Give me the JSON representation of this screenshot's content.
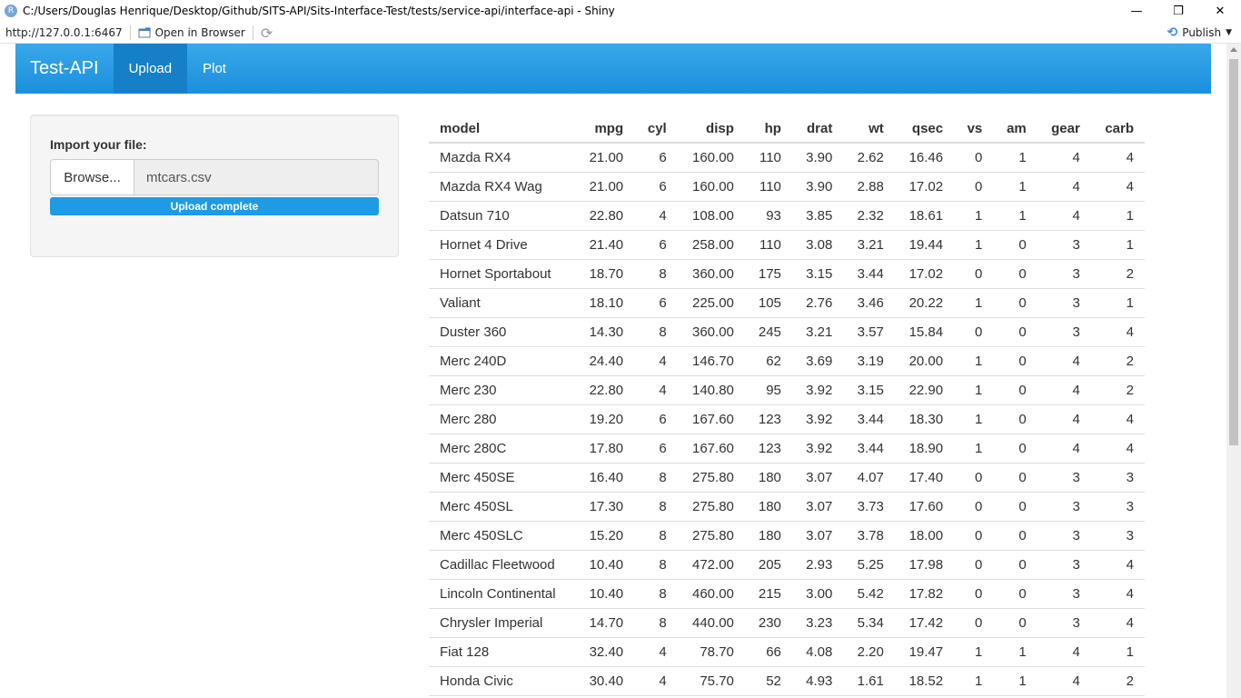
{
  "window": {
    "title": "C:/Users/Douglas Henrique/Desktop/Github/SITS-API/Sits-Interface-Test/tests/service-api/interface-api - Shiny",
    "controls": {
      "minimize": "—",
      "restore": "❐",
      "close": "✕"
    }
  },
  "toolbar": {
    "url": "http://127.0.0.1:6467",
    "open_in_browser": "Open in Browser",
    "publish": "Publish"
  },
  "navbar": {
    "brand": "Test-API",
    "tabs": [
      {
        "label": "Upload",
        "active": true
      },
      {
        "label": "Plot",
        "active": false
      }
    ],
    "color": "#2a9de6"
  },
  "sidebar": {
    "import_label": "Import your file:",
    "browse_label": "Browse...",
    "file_name": "mtcars.csv",
    "progress_text": "Upload complete",
    "progress_fraction": 1.0
  },
  "table": {
    "columns": [
      "model",
      "mpg",
      "cyl",
      "disp",
      "hp",
      "drat",
      "wt",
      "qsec",
      "vs",
      "am",
      "gear",
      "carb"
    ],
    "rows": [
      [
        "Mazda RX4",
        "21.00",
        "6",
        "160.00",
        "110",
        "3.90",
        "2.62",
        "16.46",
        "0",
        "1",
        "4",
        "4"
      ],
      [
        "Mazda RX4 Wag",
        "21.00",
        "6",
        "160.00",
        "110",
        "3.90",
        "2.88",
        "17.02",
        "0",
        "1",
        "4",
        "4"
      ],
      [
        "Datsun 710",
        "22.80",
        "4",
        "108.00",
        "93",
        "3.85",
        "2.32",
        "18.61",
        "1",
        "1",
        "4",
        "1"
      ],
      [
        "Hornet 4 Drive",
        "21.40",
        "6",
        "258.00",
        "110",
        "3.08",
        "3.21",
        "19.44",
        "1",
        "0",
        "3",
        "1"
      ],
      [
        "Hornet Sportabout",
        "18.70",
        "8",
        "360.00",
        "175",
        "3.15",
        "3.44",
        "17.02",
        "0",
        "0",
        "3",
        "2"
      ],
      [
        "Valiant",
        "18.10",
        "6",
        "225.00",
        "105",
        "2.76",
        "3.46",
        "20.22",
        "1",
        "0",
        "3",
        "1"
      ],
      [
        "Duster 360",
        "14.30",
        "8",
        "360.00",
        "245",
        "3.21",
        "3.57",
        "15.84",
        "0",
        "0",
        "3",
        "4"
      ],
      [
        "Merc 240D",
        "24.40",
        "4",
        "146.70",
        "62",
        "3.69",
        "3.19",
        "20.00",
        "1",
        "0",
        "4",
        "2"
      ],
      [
        "Merc 230",
        "22.80",
        "4",
        "140.80",
        "95",
        "3.92",
        "3.15",
        "22.90",
        "1",
        "0",
        "4",
        "2"
      ],
      [
        "Merc 280",
        "19.20",
        "6",
        "167.60",
        "123",
        "3.92",
        "3.44",
        "18.30",
        "1",
        "0",
        "4",
        "4"
      ],
      [
        "Merc 280C",
        "17.80",
        "6",
        "167.60",
        "123",
        "3.92",
        "3.44",
        "18.90",
        "1",
        "0",
        "4",
        "4"
      ],
      [
        "Merc 450SE",
        "16.40",
        "8",
        "275.80",
        "180",
        "3.07",
        "4.07",
        "17.40",
        "0",
        "0",
        "3",
        "3"
      ],
      [
        "Merc 450SL",
        "17.30",
        "8",
        "275.80",
        "180",
        "3.07",
        "3.73",
        "17.60",
        "0",
        "0",
        "3",
        "3"
      ],
      [
        "Merc 450SLC",
        "15.20",
        "8",
        "275.80",
        "180",
        "3.07",
        "3.78",
        "18.00",
        "0",
        "0",
        "3",
        "3"
      ],
      [
        "Cadillac Fleetwood",
        "10.40",
        "8",
        "472.00",
        "205",
        "2.93",
        "5.25",
        "17.98",
        "0",
        "0",
        "3",
        "4"
      ],
      [
        "Lincoln Continental",
        "10.40",
        "8",
        "460.00",
        "215",
        "3.00",
        "5.42",
        "17.82",
        "0",
        "0",
        "3",
        "4"
      ],
      [
        "Chrysler Imperial",
        "14.70",
        "8",
        "440.00",
        "230",
        "3.23",
        "5.34",
        "17.42",
        "0",
        "0",
        "3",
        "4"
      ],
      [
        "Fiat 128",
        "32.40",
        "4",
        "78.70",
        "66",
        "4.08",
        "2.20",
        "19.47",
        "1",
        "1",
        "4",
        "1"
      ],
      [
        "Honda Civic",
        "30.40",
        "4",
        "75.70",
        "52",
        "4.93",
        "1.61",
        "18.52",
        "1",
        "1",
        "4",
        "2"
      ]
    ]
  }
}
